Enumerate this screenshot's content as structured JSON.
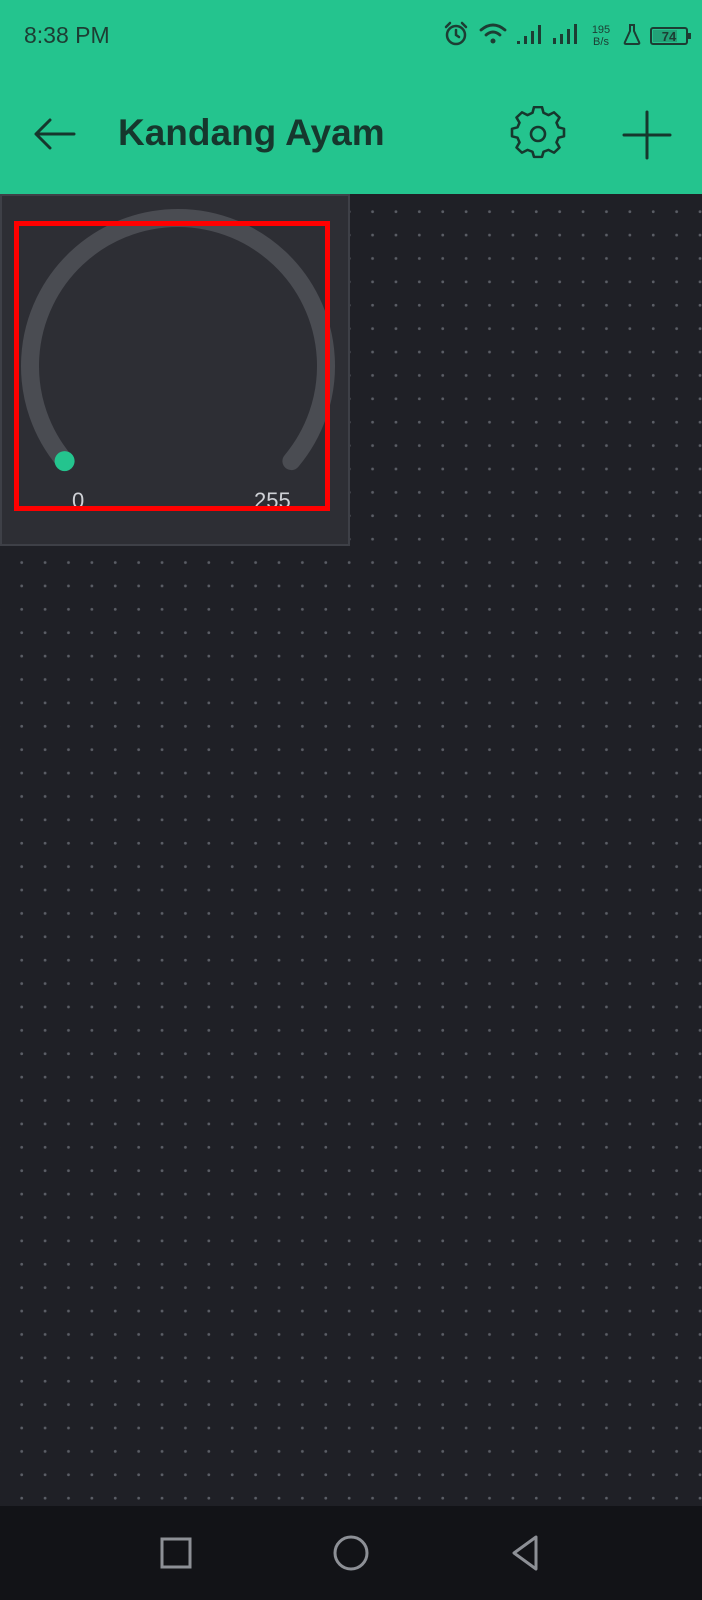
{
  "status_bar": {
    "time": "8:38 PM",
    "net_speed_value": "195",
    "net_speed_unit": "B/s",
    "battery": "74"
  },
  "header": {
    "title": "Kandang Ayam"
  },
  "widget": {
    "type": "knob",
    "min_label": "0",
    "max_label": "255",
    "value": 0,
    "accent": "#24c48e"
  },
  "colors": {
    "header_bg": "#24c48e",
    "canvas_bg": "#1f2026",
    "highlight": "#ff0000"
  },
  "icons": {
    "back": "arrow-left-icon",
    "settings": "gear-icon",
    "add": "plus-icon",
    "nav_recent": "square-icon",
    "nav_home": "circle-icon",
    "nav_back": "triangle-back-icon"
  }
}
